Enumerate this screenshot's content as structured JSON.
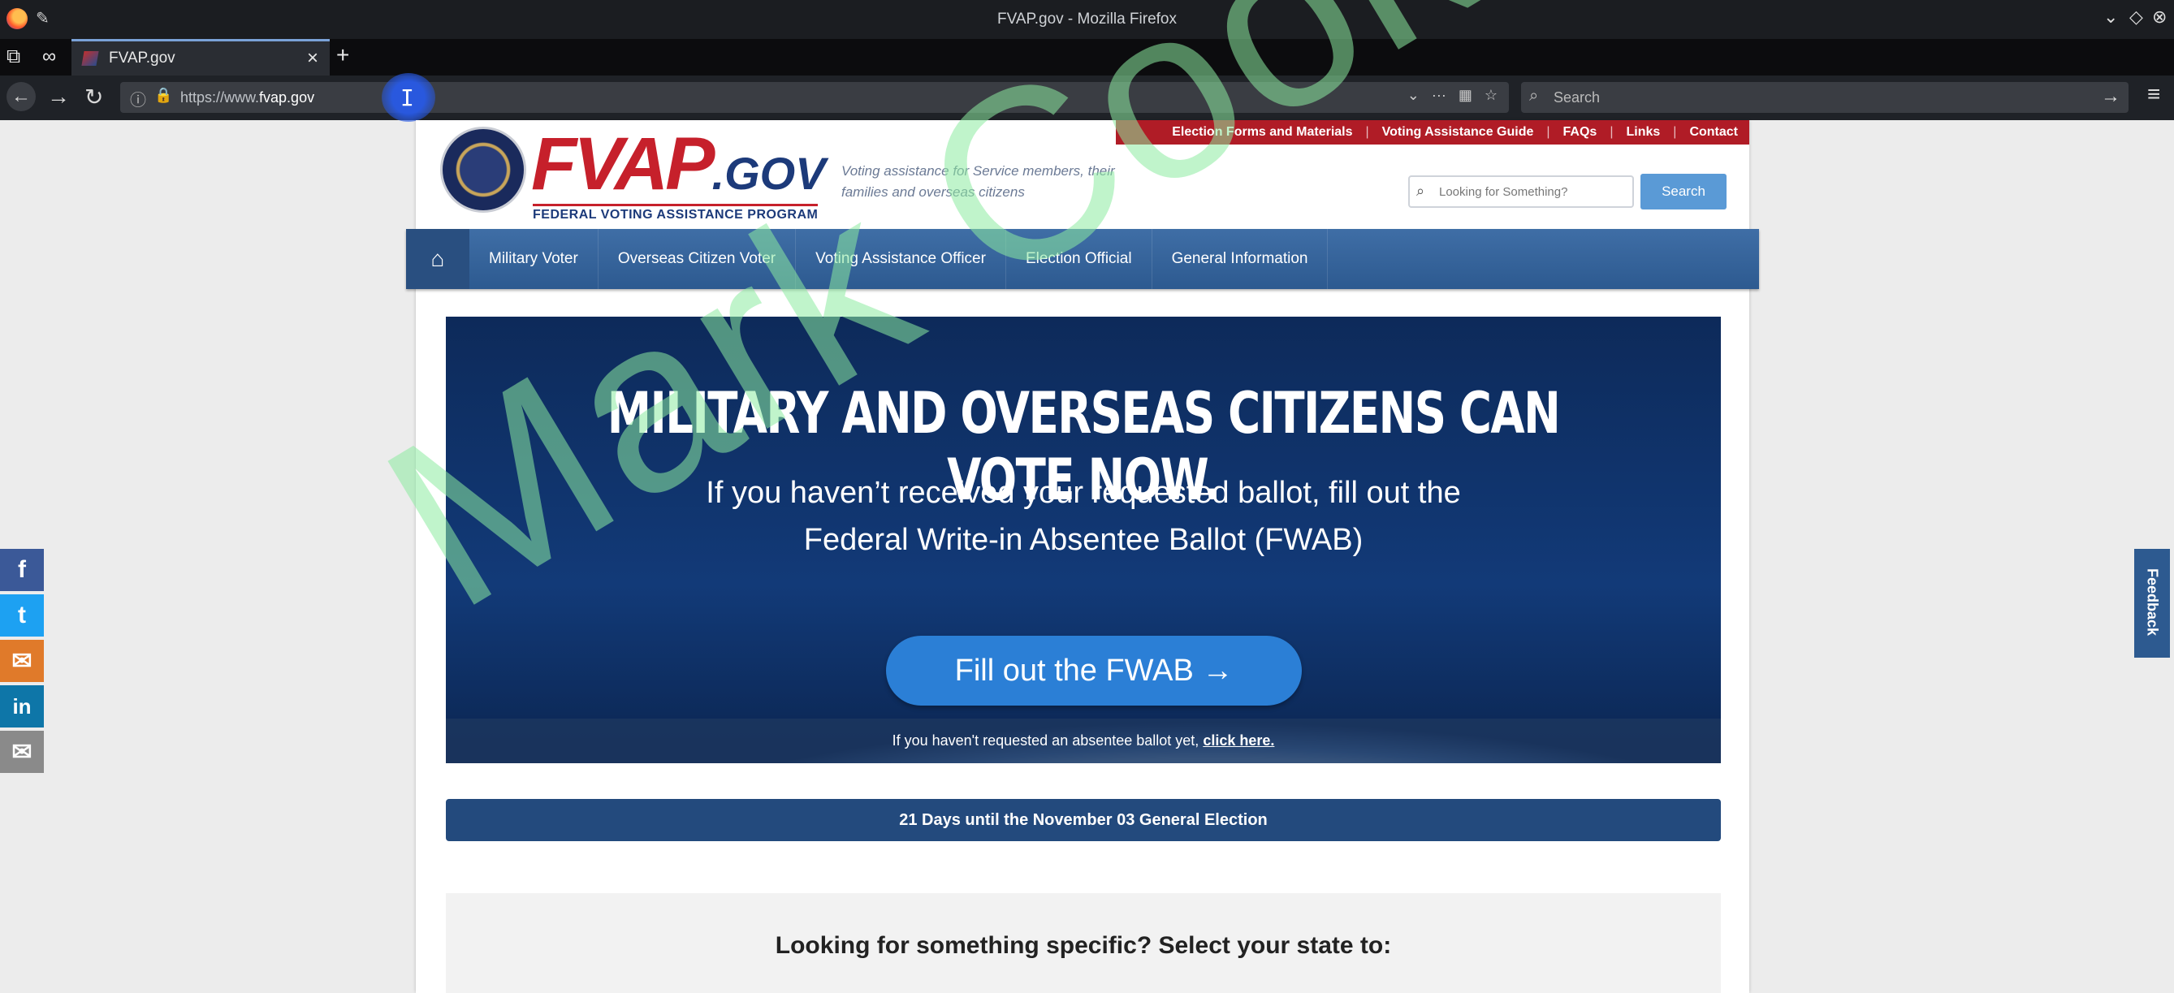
{
  "window": {
    "title": "FVAP.gov - Mozilla Firefox"
  },
  "tab": {
    "label": "FVAP.gov"
  },
  "address": {
    "url_prefix": "https://www.",
    "url_host": "fvap.gov",
    "search_placeholder": "Search"
  },
  "site": {
    "top_links": [
      "Election Forms and Materials",
      "Voting Assistance Guide",
      "FAQs",
      "Links",
      "Contact"
    ],
    "logo_fvap": "FVAP",
    "logo_gov": ".GOV",
    "logo_subtitle": "FEDERAL VOTING ASSISTANCE PROGRAM",
    "tagline": "Voting assistance for Service members, their families and overseas citizens",
    "search_placeholder": "Looking for Something?",
    "search_button": "Search",
    "nav": [
      "Military Voter",
      "Overseas Citizen Voter",
      "Voting Assistance Officer",
      "Election Official",
      "General Information"
    ]
  },
  "hero": {
    "headline": "MILITARY AND OVERSEAS CITIZENS CAN VOTE NOW.",
    "sub_line1": "If you haven’t received your requested ballot, fill out the",
    "sub_line2": "Federal Write-in Absentee Ballot (FWAB)",
    "cta": "Fill out the FWAB →",
    "strip_text": "If you haven't requested an absentee ballot yet, ",
    "strip_link": "click here."
  },
  "countdown": "21 Days until the November 03 General Election",
  "state_prompt": "Looking for something specific? Select your state to:",
  "social": [
    "f",
    "t",
    "✉",
    "in",
    "✉"
  ],
  "feedback": "Feedback",
  "watermark": "Mark Cook",
  "colors": {
    "nav_blue": "#2d5a90",
    "accent_red": "#b01c26",
    "cta_blue": "#2b7fd6"
  }
}
